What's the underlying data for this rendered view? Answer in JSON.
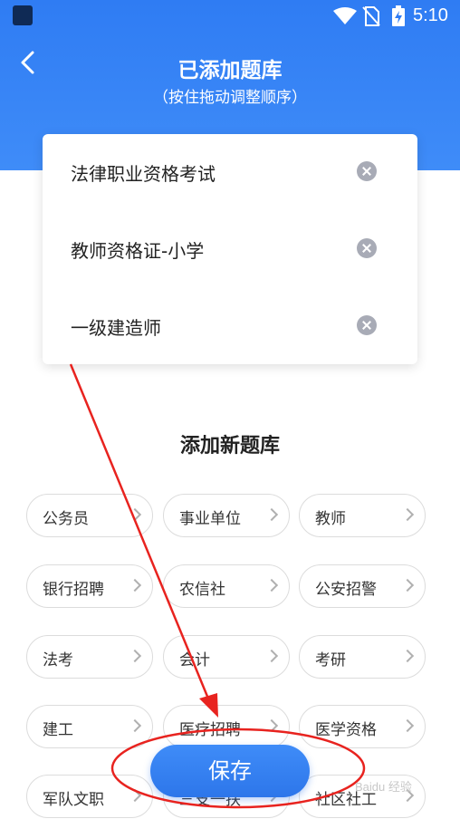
{
  "status_bar": {
    "time": "5:10"
  },
  "header": {
    "title": "已添加题库",
    "subtitle": "（按住拖动调整顺序）"
  },
  "added_banks": [
    {
      "label": "法律职业资格考试"
    },
    {
      "label": "教师资格证-小学"
    },
    {
      "label": "一级建造师"
    }
  ],
  "add_section": {
    "title": "添加新题库",
    "categories": [
      {
        "label": "公务员"
      },
      {
        "label": "事业单位"
      },
      {
        "label": "教师"
      },
      {
        "label": "银行招聘"
      },
      {
        "label": "农信社"
      },
      {
        "label": "公安招警"
      },
      {
        "label": "法考"
      },
      {
        "label": "会计"
      },
      {
        "label": "考研"
      },
      {
        "label": "建工"
      },
      {
        "label": "医疗招聘"
      },
      {
        "label": "医学资格"
      },
      {
        "label": "军队文职"
      },
      {
        "label": "三支一扶"
      },
      {
        "label": "社区社工"
      }
    ]
  },
  "save_button": {
    "label": "保存"
  },
  "colors": {
    "header_blue": "#2f7cf3",
    "annotation_red": "#e8231f"
  }
}
